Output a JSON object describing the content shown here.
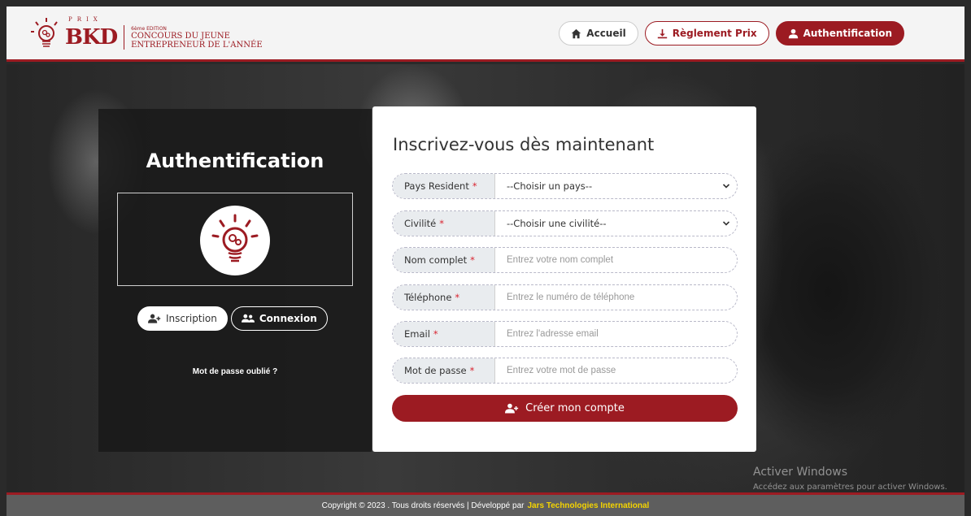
{
  "header": {
    "logo": {
      "prix": "PRIX",
      "brand": "BKD",
      "edition": "6ème EDITION",
      "line1": "CONCOURS DU JEUNE",
      "line2": "ENTREPRENEUR DE L'ANNÉE"
    },
    "nav": [
      {
        "label": "Accueil",
        "icon": "home-icon"
      },
      {
        "label": "Règlement Prix",
        "icon": "download-icon"
      },
      {
        "label": "Authentification",
        "icon": "user-icon"
      }
    ]
  },
  "left_panel": {
    "title": "Authentification",
    "tabs": [
      {
        "label": "Inscription",
        "icon": "user-plus-icon",
        "active": true
      },
      {
        "label": "Connexion",
        "icon": "users-icon",
        "active": false
      }
    ],
    "forgot_password": "Mot de passe oublié ?"
  },
  "form": {
    "title": "Inscrivez-vous dès maintenant",
    "fields": [
      {
        "label": "Pays Resident",
        "type": "select",
        "value": "--Choisir un pays--"
      },
      {
        "label": "Civilité",
        "type": "select",
        "value": "--Choisir une civilité--"
      },
      {
        "label": "Nom complet",
        "type": "text",
        "placeholder": "Entrez votre nom complet"
      },
      {
        "label": "Téléphone",
        "type": "text",
        "placeholder": "Entrez le numéro de téléphone"
      },
      {
        "label": "Email",
        "type": "text",
        "placeholder": "Entrez l'adresse email"
      },
      {
        "label": "Mot de passe",
        "type": "password",
        "placeholder": "Entrez votre mot de passe"
      }
    ],
    "required_mark": "*",
    "submit_label": "Créer mon compte"
  },
  "watermark": {
    "line1": "Activer Windows",
    "line2": "Accédez aux paramètres pour activer Windows."
  },
  "footer": {
    "copyright": "Copyright © 2023 . Tous droits réservés | Développé par",
    "developer": "Jars Technologies International"
  },
  "colors": {
    "brand": "#9c1b22",
    "required": "#d9232f",
    "developer_link": "#f5d400"
  }
}
